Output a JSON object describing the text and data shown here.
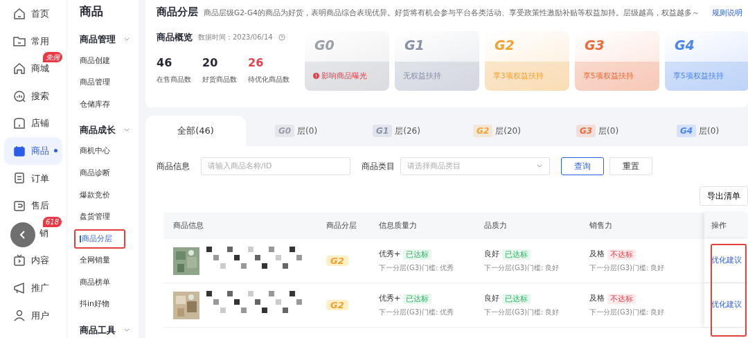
{
  "nav": [
    {
      "label": "首页",
      "selected": false
    },
    {
      "label": "常用",
      "selected": false
    },
    {
      "label": "商城",
      "selected": false,
      "badge": "免佣"
    },
    {
      "label": "搜索",
      "selected": false
    },
    {
      "label": "店铺",
      "selected": false
    },
    {
      "label": "商品",
      "selected": true
    },
    {
      "label": "订单",
      "selected": false
    },
    {
      "label": "售后",
      "selected": false
    },
    {
      "label": "销",
      "selected": false,
      "badge": "618"
    },
    {
      "label": "内容",
      "selected": false
    },
    {
      "label": "推广",
      "selected": false
    },
    {
      "label": "用户",
      "selected": false
    }
  ],
  "submenu": {
    "title": "商品",
    "groups": [
      {
        "label": "商品管理",
        "expanded": true,
        "items": [
          {
            "label": "商品创建",
            "selected": false
          },
          {
            "label": "商品管理",
            "selected": false
          },
          {
            "label": "仓储库存",
            "selected": false
          }
        ]
      },
      {
        "label": "商品成长",
        "expanded": true,
        "items": [
          {
            "label": "商机中心",
            "selected": false
          },
          {
            "label": "商品诊断",
            "selected": false
          },
          {
            "label": "爆款竞价",
            "selected": false
          },
          {
            "label": "盘货管理",
            "selected": false
          },
          {
            "label": "商品分层",
            "selected": true
          },
          {
            "label": "全网销量",
            "selected": false
          },
          {
            "label": "商品榜单",
            "selected": false
          },
          {
            "label": "抖in好物",
            "selected": false
          }
        ]
      },
      {
        "label": "商品工具",
        "expanded": true
      }
    ]
  },
  "header": {
    "title": "商品分层",
    "description": "商品层级G2-G4的商品为好货，表明商品综合表现优异。好货将有机会参与平台各类活动、享受政策性激励补贴等权益加持。层级越高，权益越多～",
    "link": "规则说明"
  },
  "overview": {
    "title": "商品概览",
    "time": "数据时间：2023/06/14",
    "stats": [
      {
        "value": "46",
        "label": "在售商品数",
        "warn": false
      },
      {
        "value": "20",
        "label": "好货商品数",
        "warn": false
      },
      {
        "value": "26",
        "label": "待优化商品数",
        "warn": true
      }
    ]
  },
  "tiers": [
    {
      "name": "G0",
      "benefit": "影响商品曝光",
      "color": "#9a9ea8",
      "warn": true
    },
    {
      "name": "G1",
      "benefit": "无权益扶持",
      "color": "#8891a8",
      "warn": false
    },
    {
      "name": "G2",
      "benefit": "享3项权益扶持",
      "color": "#f0a233",
      "warn": false
    },
    {
      "name": "G3",
      "benefit": "享5项权益扶持",
      "color": "#ec6b3a",
      "warn": false
    },
    {
      "name": "G4",
      "benefit": "享5项权益扶持",
      "color": "#4a86f0",
      "warn": false
    }
  ],
  "tabs": [
    {
      "label": "全部(46)",
      "selected": true
    },
    {
      "tier": "G0",
      "label": "层(0)",
      "color": "#9a9ea8",
      "selected": false
    },
    {
      "tier": "G1",
      "label": "层(26)",
      "color": "#8891a8",
      "selected": false
    },
    {
      "tier": "G2",
      "label": "层(20)",
      "color": "#f0a233",
      "selected": false
    },
    {
      "tier": "G3",
      "label": "层(0)",
      "color": "#ec6b3a",
      "selected": false
    },
    {
      "tier": "G4",
      "label": "层(0)",
      "color": "#4a86f0",
      "selected": false
    }
  ],
  "filters": {
    "info_label": "商品信息",
    "info_placeholder": "请输入商品名称/ID",
    "category_label": "商品类目",
    "category_placeholder": "请选择商品类目",
    "buttons": [
      "查询",
      "重置"
    ]
  },
  "export_button": "导出清单",
  "table": {
    "columns": [
      "商品信息",
      "商品分层",
      "信息质量力",
      "品质力",
      "销售力",
      "操作"
    ],
    "rows": [
      {
        "tier": "G2",
        "metrics": [
          {
            "grade": "优秀+",
            "status": "已达标",
            "passed": true,
            "next": "下一分层(G3)门槛: 优秀"
          },
          {
            "grade": "良好",
            "status": "已达标",
            "passed": true,
            "next": "下一分层(G3)门槛: 良好"
          },
          {
            "grade": "及格",
            "status": "不达标",
            "passed": false,
            "next": "下一分层(G3)门槛: 良好"
          }
        ],
        "action": "优化建议"
      },
      {
        "tier": "G2",
        "metrics": [
          {
            "grade": "优秀+",
            "status": "已达标",
            "passed": true,
            "next": "下一分层(G3)门槛: 优秀"
          },
          {
            "grade": "良好",
            "status": "已达标",
            "passed": true,
            "next": "下一分层(G3)门槛: 良好"
          },
          {
            "grade": "及格",
            "status": "不达标",
            "passed": false,
            "next": "下一分层(G3)门槛: 良好"
          }
        ],
        "action": "优化建议"
      }
    ]
  }
}
